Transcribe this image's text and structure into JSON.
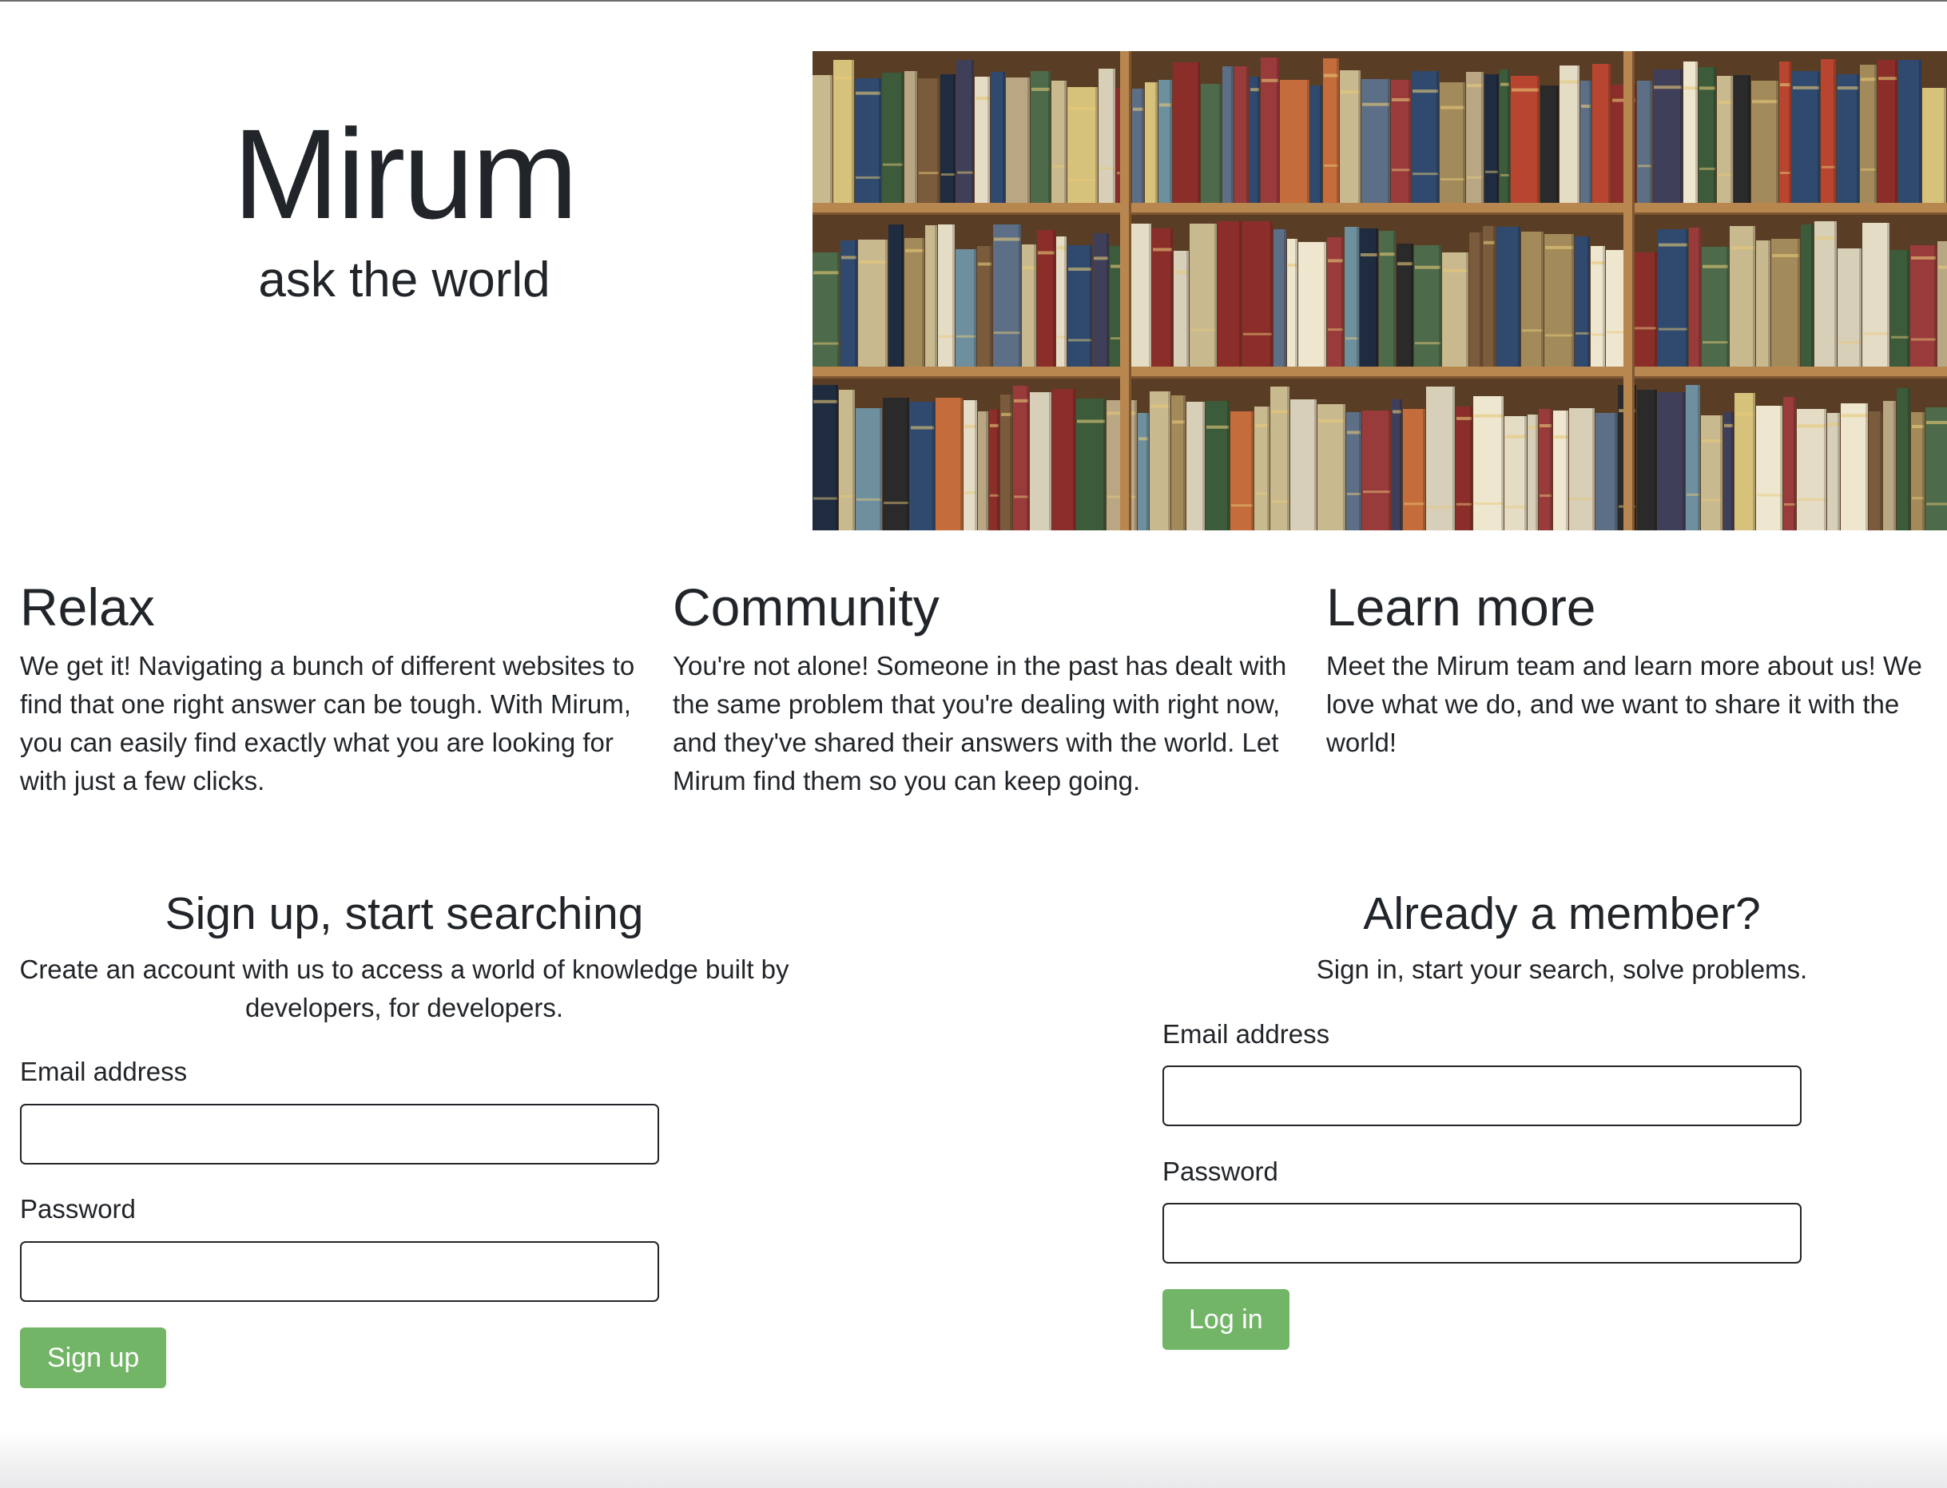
{
  "hero": {
    "title": "Mirum",
    "subtitle": "ask the world"
  },
  "features": [
    {
      "title": "Relax",
      "body": "We get it! Navigating a bunch of different websites to find that one right answer can be tough. With Mirum, you can easily find exactly what you are looking for with just a few clicks."
    },
    {
      "title": "Community",
      "body": "You're not alone! Someone in the past has dealt with the same problem that you're dealing with right now, and they've shared their answers with the world. Let Mirum find them so you can keep going."
    },
    {
      "title": "Learn more",
      "body": "Meet the Mirum team and learn more about us! We love what we do, and we want to share it with the world!"
    }
  ],
  "signup": {
    "heading": "Sign up, start searching",
    "lead": "Create an account with us to access a world of knowledge built by developers, for developers.",
    "email_label": "Email address",
    "email_value": "",
    "password_label": "Password",
    "password_value": "",
    "button_label": "Sign up"
  },
  "login": {
    "heading": "Already a member?",
    "lead": "Sign in, start your search, solve problems.",
    "email_label": "Email address",
    "email_value": "",
    "password_label": "Password",
    "password_value": "",
    "button_label": "Log in"
  },
  "colors": {
    "accent_button": "#73b567",
    "text": "#212529",
    "input_border": "#212529"
  }
}
